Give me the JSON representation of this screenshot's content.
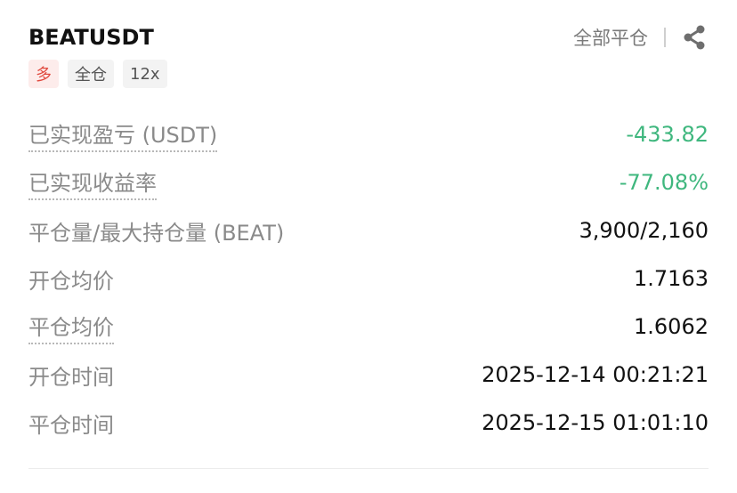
{
  "header": {
    "symbol": "BEATUSDT",
    "close_all_label": "全部平仓",
    "share_icon": "share-icon"
  },
  "tags": [
    "多",
    "全仓",
    "12x"
  ],
  "colors": {
    "long_tag_text": "#e04a3f",
    "long_tag_bg": "#fdeceb",
    "negative_value": "#3fb77e"
  },
  "rows": [
    {
      "label": "已实现盈亏 (USDT)",
      "value": "-433.82"
    },
    {
      "label": "已实现收益率",
      "value": "-77.08%"
    },
    {
      "label": "平仓量/最大持仓量 (BEAT)",
      "value": "3,900/2,160"
    },
    {
      "label": "开仓均价",
      "value": "1.7163"
    },
    {
      "label": "平仓均价",
      "value": "1.6062"
    },
    {
      "label": "开仓时间",
      "value": "2025-12-14 00:21:21"
    },
    {
      "label": "平仓时间",
      "value": "2025-12-15 01:01:10"
    }
  ]
}
